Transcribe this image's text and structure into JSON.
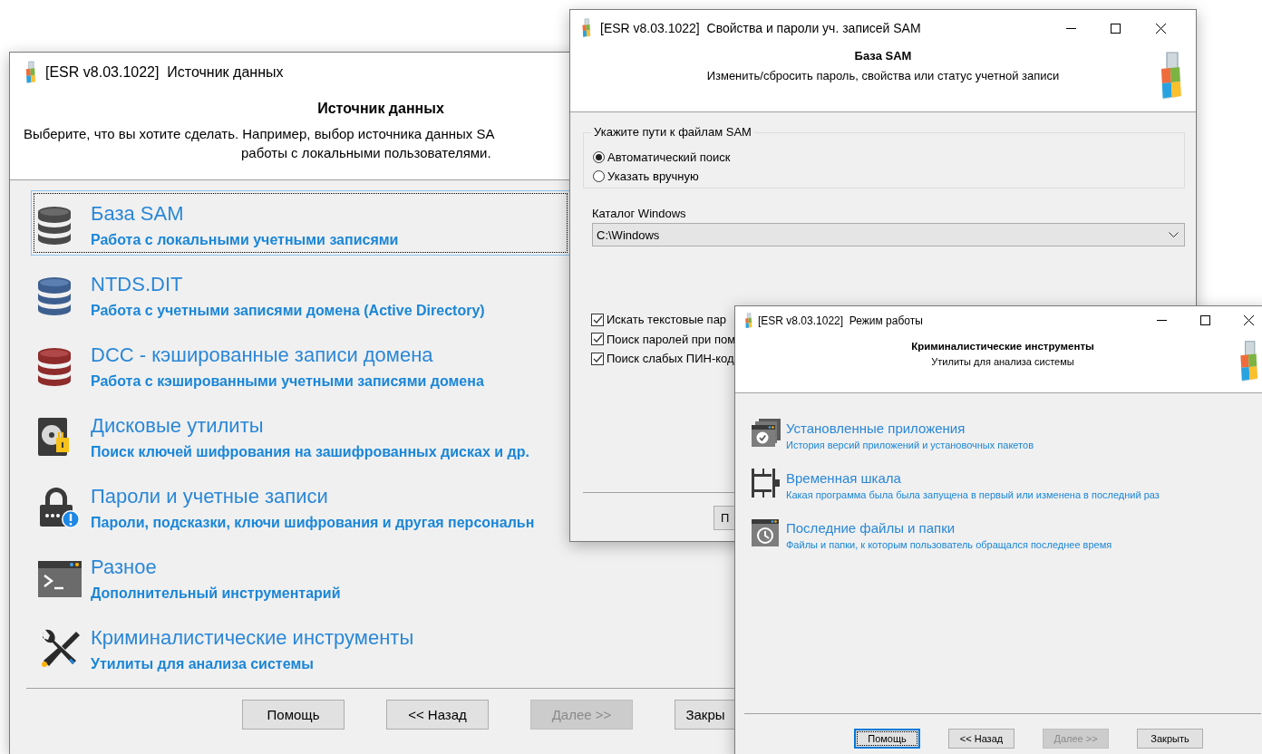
{
  "source_window": {
    "title": "[ESR v8.03.1022]  Источник данных",
    "header": {
      "title": "Источник данных",
      "description": [
        "Выберите, что вы хотите сделать. Например, выбор источника данных SA",
        "работы с локальными пользователями."
      ]
    },
    "items": [
      {
        "kind": "sam",
        "title": "База SAM",
        "subtitle": "Работа с локальными учетными записями",
        "selected": true
      },
      {
        "kind": "ntds",
        "title": "NTDS.DIT",
        "subtitle": "Работа с учетными записями домена (Active Directory)",
        "selected": false
      },
      {
        "kind": "dcc",
        "title": "DCC - кэшированные записи домена",
        "subtitle": "Работа с кэшированными учетными записями домена",
        "selected": false
      },
      {
        "kind": "disk",
        "title": "Дисковые утилиты",
        "subtitle": "Поиск ключей шифрования на зашифрованных дисках и др.",
        "selected": false
      },
      {
        "kind": "passwords",
        "title": "Пароли и учетные записи",
        "subtitle": "Пароли, подсказки, ключи шифрования и другая персональн",
        "selected": false
      },
      {
        "kind": "misc",
        "title": "Разное",
        "subtitle": "Дополнительный инструментарий",
        "selected": false
      },
      {
        "kind": "forensic",
        "title": "Криминалистические инструменты",
        "subtitle": "Утилиты для анализа системы",
        "selected": false
      }
    ],
    "buttons": [
      {
        "label": "Помощь",
        "disabled": false,
        "default": false
      },
      {
        "label": "<< Назад",
        "disabled": false,
        "default": false
      },
      {
        "label": "Далее >>",
        "disabled": true,
        "default": false
      },
      {
        "label": "Закры",
        "disabled": false,
        "default": false
      }
    ]
  },
  "sam_window": {
    "title": "[ESR v8.03.1022]  Свойства и пароли уч. записей SAM",
    "header": {
      "title": "База SAM",
      "subtitle": "Изменить/сбросить пароль, свойства или статус учетной записи"
    },
    "group": {
      "legend": "Укажите пути к файлам SAM",
      "options": [
        {
          "label": "Автоматический поиск",
          "selected": true
        },
        {
          "label": "Указать вручную",
          "selected": false
        }
      ]
    },
    "catalog": {
      "label": "Каталог Windows",
      "value": "C:\\Windows"
    },
    "checkboxes": [
      {
        "label": "Искать текстовые пар",
        "checked": true
      },
      {
        "label": "Поиск паролей при пом",
        "checked": true
      },
      {
        "label": "Поиск слабых ПИН-код",
        "checked": true
      }
    ],
    "buttons": [
      {
        "label": "П",
        "disabled": false,
        "default": false
      }
    ]
  },
  "mode_window": {
    "title": "[ESR v8.03.1022]  Режим работы",
    "header": {
      "title": "Криминалистические инструменты",
      "subtitle": "Утилиты для анализа системы"
    },
    "items": [
      {
        "kind": "apps",
        "title": "Установленные приложения",
        "subtitle": "История версий приложений и установочных пакетов"
      },
      {
        "kind": "timeline",
        "title": "Временная шкала",
        "subtitle": "Какая программа была была запущена в первый или изменена в последний раз"
      },
      {
        "kind": "recent",
        "title": "Последние файлы и папки",
        "subtitle": "Файлы и папки, к которым пользователь обращался последнее время"
      }
    ],
    "buttons": [
      {
        "label": "Помощь",
        "disabled": false,
        "default": true
      },
      {
        "label": "<< Назад",
        "disabled": false,
        "default": false
      },
      {
        "label": "Далее >>",
        "disabled": true,
        "default": false
      },
      {
        "label": "Закрыть",
        "disabled": false,
        "default": false
      }
    ]
  }
}
